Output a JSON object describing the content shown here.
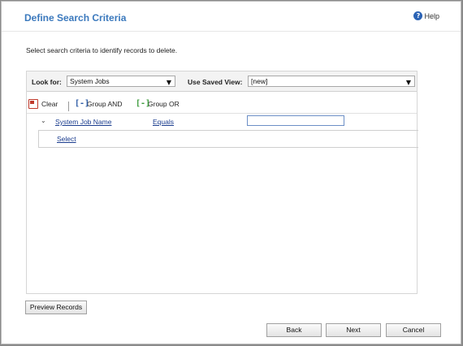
{
  "header": {
    "title": "Define Search Criteria",
    "help_label": "Help"
  },
  "description": "Select search criteria to identify records to delete.",
  "look_for": {
    "label": "Look for:",
    "value": "System Jobs"
  },
  "saved_view": {
    "label": "Use Saved View:",
    "value": "[new]"
  },
  "toolbar": {
    "clear": "Clear",
    "group_and": "Group AND",
    "group_or": "Group OR"
  },
  "criteria": {
    "field": "System Job Name",
    "operator": "Equals",
    "value": "",
    "select_link": "Select"
  },
  "buttons": {
    "preview": "Preview Records",
    "back": "Back",
    "next": "Next",
    "cancel": "Cancel"
  },
  "icons": [
    "help-icon",
    "clear-icon",
    "group-and-icon",
    "group-or-icon",
    "chevron-down-icon"
  ]
}
